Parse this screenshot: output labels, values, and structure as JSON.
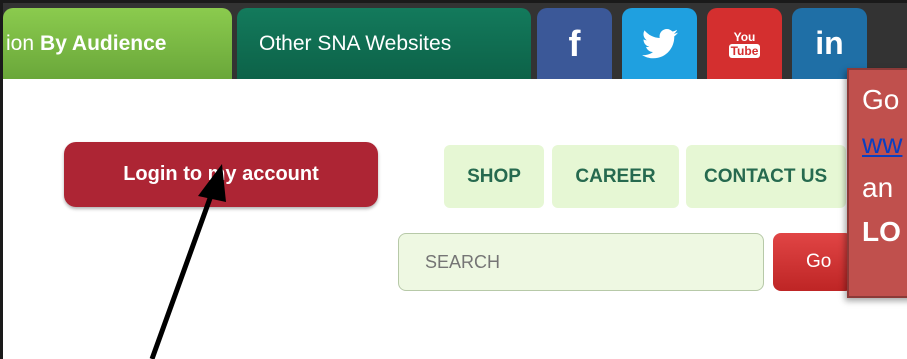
{
  "topbar": {
    "tab_audience_prefix": "ion",
    "tab_audience_bold": "By Audience",
    "tab_other": "Other SNA Websites",
    "social": {
      "facebook": "f",
      "youtube_top": "You",
      "youtube_bottom": "Tube",
      "linkedin": "in"
    }
  },
  "login": {
    "label": "Login to my account"
  },
  "nav": {
    "shop": "SHOP",
    "career": "CAREER",
    "contact": "CONTACT US"
  },
  "search": {
    "placeholder": "SEARCH",
    "go_label": "Go"
  },
  "callout": {
    "line1": "Go",
    "line2": "ww",
    "line3": "an",
    "line4": "LO"
  },
  "colors": {
    "login": "#ad2534",
    "callout": "#c0504d",
    "audience_tab": "#7ab845",
    "other_tab": "#137a5c"
  }
}
